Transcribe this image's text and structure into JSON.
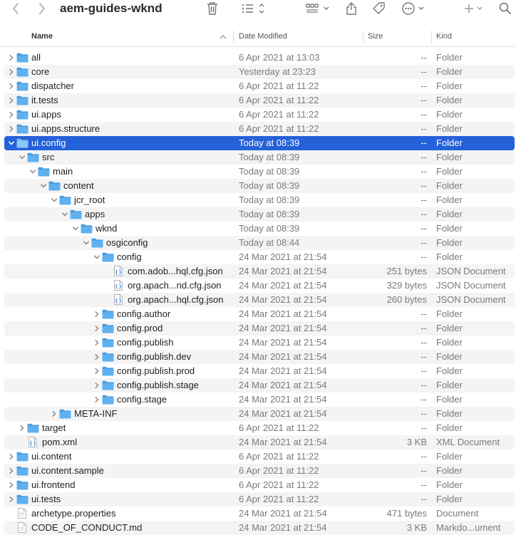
{
  "toolbar": {
    "title": "aem-guides-wknd",
    "icons": [
      "back-icon",
      "forward-icon",
      "trash-icon",
      "list-view-icon",
      "group-icon",
      "share-icon",
      "tag-icon",
      "more-icon",
      "add-icon",
      "search-icon"
    ]
  },
  "columns": {
    "name": "Name",
    "date": "Date Modified",
    "size": "Size",
    "kind": "Kind"
  },
  "colors": {
    "selection": "#2561d8",
    "folder": "#5fb0ef",
    "folder_dark": "#4a9de0"
  },
  "rows": [
    {
      "name": "all",
      "date": "6 Apr 2021 at 13:03",
      "size": "--",
      "kind": "Folder",
      "depth": 0,
      "type": "folder",
      "state": "closed"
    },
    {
      "name": "core",
      "date": "Yesterday at 23:23",
      "size": "--",
      "kind": "Folder",
      "depth": 0,
      "type": "folder",
      "state": "closed"
    },
    {
      "name": "dispatcher",
      "date": "6 Apr 2021 at 11:22",
      "size": "--",
      "kind": "Folder",
      "depth": 0,
      "type": "folder",
      "state": "closed"
    },
    {
      "name": "it.tests",
      "date": "6 Apr 2021 at 11:22",
      "size": "--",
      "kind": "Folder",
      "depth": 0,
      "type": "folder",
      "state": "closed"
    },
    {
      "name": "ui.apps",
      "date": "6 Apr 2021 at 11:22",
      "size": "--",
      "kind": "Folder",
      "depth": 0,
      "type": "folder",
      "state": "closed"
    },
    {
      "name": "ui.apps.structure",
      "date": "6 Apr 2021 at 11:22",
      "size": "--",
      "kind": "Folder",
      "depth": 0,
      "type": "folder",
      "state": "closed"
    },
    {
      "name": "ui.config",
      "date": "Today at 08:39",
      "size": "--",
      "kind": "Folder",
      "depth": 0,
      "type": "folder",
      "state": "open",
      "selected": true
    },
    {
      "name": "src",
      "date": "Today at 08:39",
      "size": "--",
      "kind": "Folder",
      "depth": 1,
      "type": "folder",
      "state": "open"
    },
    {
      "name": "main",
      "date": "Today at 08:39",
      "size": "--",
      "kind": "Folder",
      "depth": 2,
      "type": "folder",
      "state": "open"
    },
    {
      "name": "content",
      "date": "Today at 08:39",
      "size": "--",
      "kind": "Folder",
      "depth": 3,
      "type": "folder",
      "state": "open"
    },
    {
      "name": "jcr_root",
      "date": "Today at 08:39",
      "size": "--",
      "kind": "Folder",
      "depth": 4,
      "type": "folder",
      "state": "open"
    },
    {
      "name": "apps",
      "date": "Today at 08:39",
      "size": "--",
      "kind": "Folder",
      "depth": 5,
      "type": "folder",
      "state": "open"
    },
    {
      "name": "wknd",
      "date": "Today at 08:39",
      "size": "--",
      "kind": "Folder",
      "depth": 6,
      "type": "folder",
      "state": "open"
    },
    {
      "name": "osgiconfig",
      "date": "Today at 08:44",
      "size": "--",
      "kind": "Folder",
      "depth": 7,
      "type": "folder",
      "state": "open"
    },
    {
      "name": "config",
      "date": "24 Mar 2021 at 21:54",
      "size": "--",
      "kind": "Folder",
      "depth": 8,
      "type": "folder",
      "state": "open"
    },
    {
      "name": "com.adob...hql.cfg.json",
      "date": "24 Mar 2021 at 21:54",
      "size": "251 bytes",
      "kind": "JSON Document",
      "depth": 9,
      "type": "json",
      "state": "none"
    },
    {
      "name": "org.apach...nd.cfg.json",
      "date": "24 Mar 2021 at 21:54",
      "size": "329 bytes",
      "kind": "JSON Document",
      "depth": 9,
      "type": "json",
      "state": "none"
    },
    {
      "name": "org.apach...hql.cfg.json",
      "date": "24 Mar 2021 at 21:54",
      "size": "260 bytes",
      "kind": "JSON Document",
      "depth": 9,
      "type": "json",
      "state": "none"
    },
    {
      "name": "config.author",
      "date": "24 Mar 2021 at 21:54",
      "size": "--",
      "kind": "Folder",
      "depth": 8,
      "type": "folder",
      "state": "closed"
    },
    {
      "name": "config.prod",
      "date": "24 Mar 2021 at 21:54",
      "size": "--",
      "kind": "Folder",
      "depth": 8,
      "type": "folder",
      "state": "closed"
    },
    {
      "name": "config.publish",
      "date": "24 Mar 2021 at 21:54",
      "size": "--",
      "kind": "Folder",
      "depth": 8,
      "type": "folder",
      "state": "closed"
    },
    {
      "name": "config.publish.dev",
      "date": "24 Mar 2021 at 21:54",
      "size": "--",
      "kind": "Folder",
      "depth": 8,
      "type": "folder",
      "state": "closed"
    },
    {
      "name": "config.publish.prod",
      "date": "24 Mar 2021 at 21:54",
      "size": "--",
      "kind": "Folder",
      "depth": 8,
      "type": "folder",
      "state": "closed"
    },
    {
      "name": "config.publish.stage",
      "date": "24 Mar 2021 at 21:54",
      "size": "--",
      "kind": "Folder",
      "depth": 8,
      "type": "folder",
      "state": "closed"
    },
    {
      "name": "config.stage",
      "date": "24 Mar 2021 at 21:54",
      "size": "--",
      "kind": "Folder",
      "depth": 8,
      "type": "folder",
      "state": "closed"
    },
    {
      "name": "META-INF",
      "date": "24 Mar 2021 at 21:54",
      "size": "--",
      "kind": "Folder",
      "depth": 4,
      "type": "folder",
      "state": "closed"
    },
    {
      "name": "target",
      "date": "6 Apr 2021 at 11:22",
      "size": "--",
      "kind": "Folder",
      "depth": 1,
      "type": "folder",
      "state": "closed"
    },
    {
      "name": "pom.xml",
      "date": "24 Mar 2021 at 21:54",
      "size": "3 KB",
      "kind": "XML Document",
      "depth": 1,
      "type": "xml",
      "state": "none"
    },
    {
      "name": "ui.content",
      "date": "6 Apr 2021 at 11:22",
      "size": "--",
      "kind": "Folder",
      "depth": 0,
      "type": "folder",
      "state": "closed"
    },
    {
      "name": "ui.content.sample",
      "date": "6 Apr 2021 at 11:22",
      "size": "--",
      "kind": "Folder",
      "depth": 0,
      "type": "folder",
      "state": "closed"
    },
    {
      "name": "ui.frontend",
      "date": "6 Apr 2021 at 11:22",
      "size": "--",
      "kind": "Folder",
      "depth": 0,
      "type": "folder",
      "state": "closed"
    },
    {
      "name": "ui.tests",
      "date": "6 Apr 2021 at 11:22",
      "size": "--",
      "kind": "Folder",
      "depth": 0,
      "type": "folder",
      "state": "closed"
    },
    {
      "name": "archetype.properties",
      "date": "24 Mar 2021 at 21:54",
      "size": "471 bytes",
      "kind": "Document",
      "depth": 0,
      "type": "doc",
      "state": "none"
    },
    {
      "name": "CODE_OF_CONDUCT.md",
      "date": "24 Mar 2021 at 21:54",
      "size": "3 KB",
      "kind": "Markdo...ument",
      "depth": 0,
      "type": "md",
      "state": "none"
    }
  ]
}
